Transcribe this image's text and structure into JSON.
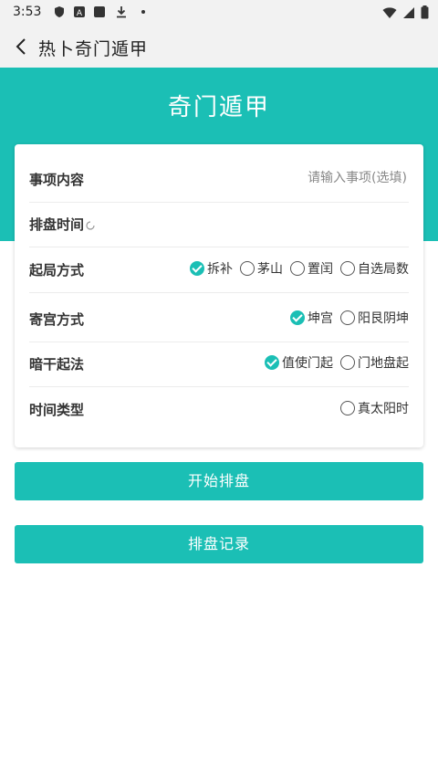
{
  "status": {
    "time": "3:53",
    "icons": [
      "shield-icon",
      "a-box-icon",
      "square-icon",
      "download-icon",
      "dot-icon",
      "wifi-icon",
      "signal-icon",
      "battery-icon"
    ]
  },
  "appbar": {
    "title": "热卜奇门遁甲",
    "back_icon": "chevron-left-icon"
  },
  "hero": {
    "title": "奇门遁甲"
  },
  "form": {
    "matter": {
      "label": "事项内容",
      "placeholder": "请输入事项(选填)",
      "value": ""
    },
    "time": {
      "label": "排盘时间",
      "value": ""
    },
    "start_method": {
      "label": "起局方式",
      "options": [
        {
          "label": "拆补",
          "checked": true
        },
        {
          "label": "茅山",
          "checked": false
        },
        {
          "label": "置闰",
          "checked": false
        },
        {
          "label": "自选局数",
          "checked": false
        }
      ]
    },
    "palace_method": {
      "label": "寄宫方式",
      "options": [
        {
          "label": "坤宫",
          "checked": true
        },
        {
          "label": "阳艮阴坤",
          "checked": false
        }
      ]
    },
    "hidden_stem": {
      "label": "暗干起法",
      "options": [
        {
          "label": "值使门起",
          "checked": true
        },
        {
          "label": "门地盘起",
          "checked": false
        }
      ]
    },
    "time_type": {
      "label": "时间类型",
      "options": [
        {
          "label": "真太阳时",
          "checked": false
        }
      ]
    }
  },
  "buttons": {
    "start": "开始排盘",
    "records": "排盘记录"
  },
  "colors": {
    "accent": "#1bbfb5",
    "background": "#ffffff",
    "appbar": "#f2f2f2"
  }
}
